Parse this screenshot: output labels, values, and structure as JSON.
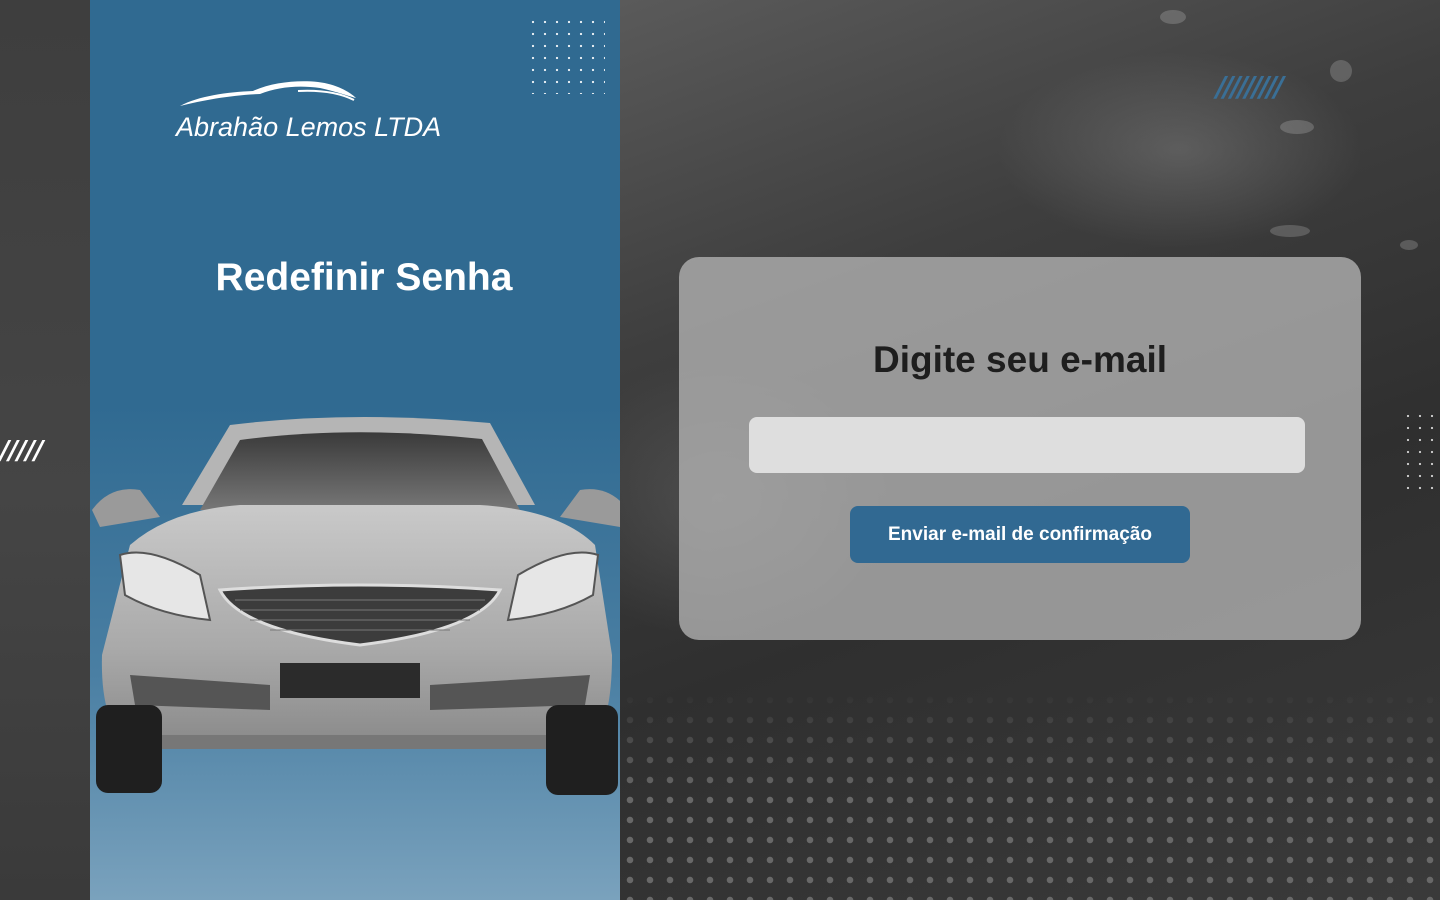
{
  "brand": {
    "company_name": "Abrahão Lemos LTDA",
    "accent_color": "#306a91",
    "logo_icon": "car-silhouette-icon"
  },
  "left_panel": {
    "title": "Redefinir Senha",
    "decor_slashes": "/////",
    "illustration": "sedan-car-front-icon"
  },
  "form": {
    "title": "Digite seu e-mail",
    "email_value": "",
    "email_placeholder": "",
    "submit_label": "Enviar e-mail de confirmação"
  },
  "decor": {
    "top_right_slashes": "/////////"
  }
}
